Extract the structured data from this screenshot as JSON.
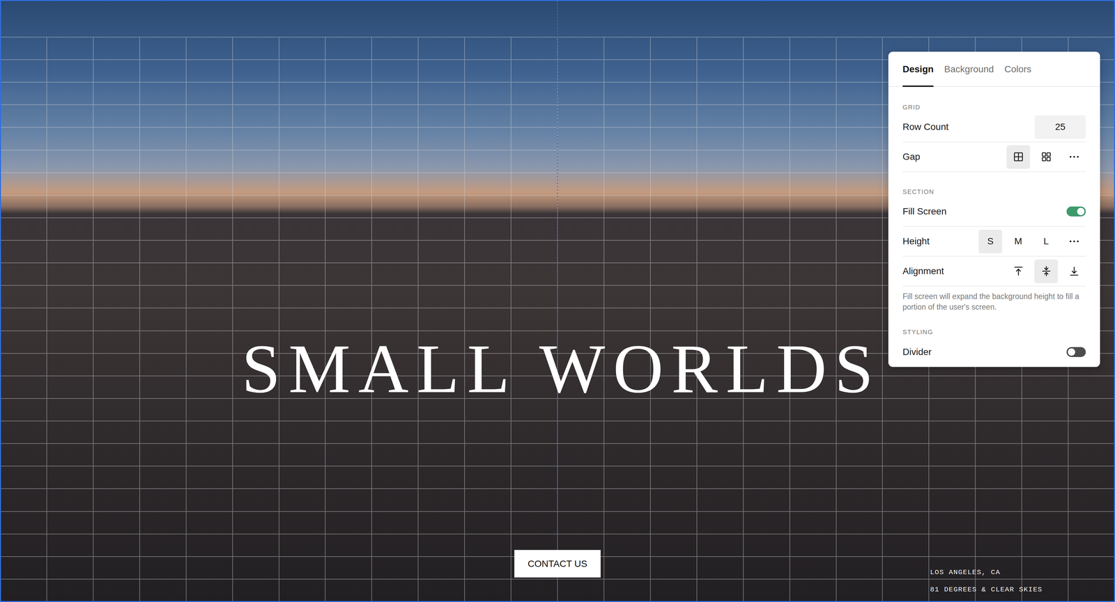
{
  "hero": {
    "title": "SMALL WORLDS",
    "button": "CONTACT US",
    "location": [
      "LOS ANGELES, CA",
      "81 DEGREES & CLEAR SKIES"
    ]
  },
  "panel": {
    "tabs": [
      {
        "label": "Design",
        "selected": true
      },
      {
        "label": "Background",
        "selected": false
      },
      {
        "label": "Colors",
        "selected": false
      }
    ],
    "groups": [
      {
        "label": "GRID",
        "rows": [
          {
            "kind": "number",
            "label": "Row Count",
            "value": "25"
          },
          {
            "kind": "options",
            "label": "Gap",
            "options": [
              {
                "kind": "joined",
                "selected": true
              },
              {
                "kind": "separated",
                "selected": false
              },
              {
                "kind": "more",
                "selected": false
              }
            ]
          }
        ]
      },
      {
        "label": "SECTION",
        "rows": [
          {
            "kind": "toggle",
            "label": "Fill Screen",
            "on": true
          },
          {
            "kind": "options",
            "label": "Height",
            "options": [
              {
                "kind": "text",
                "label": "S",
                "selected": true
              },
              {
                "kind": "text",
                "label": "M",
                "selected": false
              },
              {
                "kind": "text",
                "label": "L",
                "selected": false
              },
              {
                "kind": "more",
                "selected": false
              }
            ]
          },
          {
            "kind": "options",
            "label": "Alignment",
            "options": [
              {
                "kind": "top",
                "selected": false
              },
              {
                "kind": "center",
                "selected": true
              },
              {
                "kind": "bottom",
                "selected": false
              }
            ]
          }
        ],
        "note": "Fill screen will expand the background height to fill a portion of the user's screen."
      },
      {
        "label": "STYLING",
        "rows": [
          {
            "kind": "toggle",
            "label": "Divider",
            "on": false
          }
        ]
      }
    ]
  }
}
